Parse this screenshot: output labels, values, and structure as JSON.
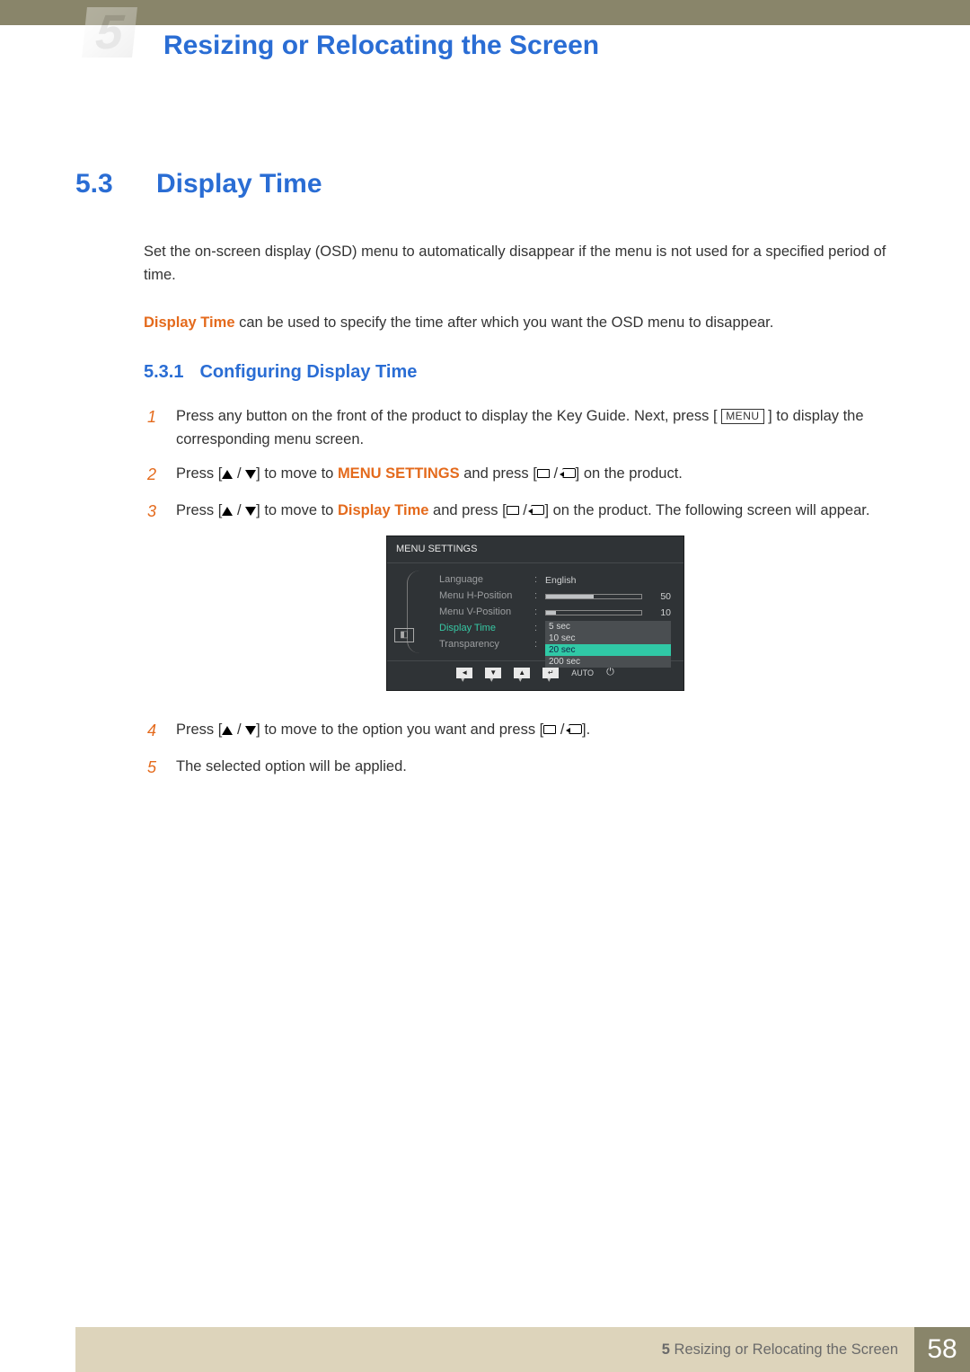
{
  "header": {
    "chapterNumber": "5",
    "chapterTitle": "Resizing or Relocating the Screen"
  },
  "section": {
    "number": "5.3",
    "title": "Display Time",
    "intro1": "Set the on-screen display (OSD) menu to automatically disappear if the menu is not used for a specified period of time.",
    "intro2Highlight": "Display Time",
    "intro2Rest": " can be used to specify the time after which you want the OSD menu to disappear."
  },
  "subsection": {
    "number": "5.3.1",
    "title": "Configuring Display Time"
  },
  "glyphs": {
    "menu": "MENU"
  },
  "steps": [
    {
      "n": "1",
      "a": "Press any button on the front of the product to display the Key Guide. Next, press [",
      "b": "] to display the corresponding menu screen."
    },
    {
      "n": "2",
      "a": "Press ",
      "b": " to move to ",
      "target": "MENU SETTINGS",
      "c": " and press ",
      "d": " on the product."
    },
    {
      "n": "3",
      "a": "Press ",
      "b": " to move to ",
      "target": "Display Time",
      "c": " and press ",
      "d": " on the product. The following screen will appear."
    },
    {
      "n": "4",
      "a": "Press ",
      "b": " to move to the option you want and press "
    },
    {
      "n": "5",
      "a": "The selected option will be applied."
    }
  ],
  "osd": {
    "title": "MENU SETTINGS",
    "rows": [
      {
        "label": "Language",
        "value": "English"
      },
      {
        "label": "Menu H-Position",
        "value": "50"
      },
      {
        "label": "Menu V-Position",
        "value": "10"
      },
      {
        "label": "Display Time",
        "options": [
          "5 sec",
          "10 sec",
          "20 sec",
          "200 sec"
        ],
        "selectedIndex": 2
      },
      {
        "label": "Transparency"
      }
    ],
    "nav": {
      "auto": "AUTO"
    }
  },
  "footer": {
    "chapterNum": "5 ",
    "chapterTitle": "Resizing or Relocating the Screen",
    "pageNumber": "58"
  }
}
